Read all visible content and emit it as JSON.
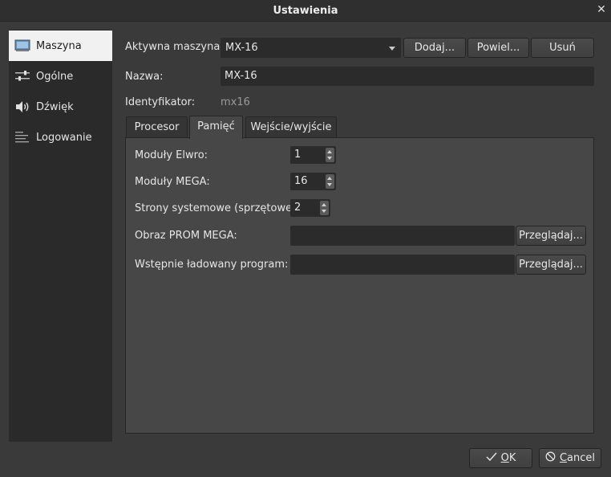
{
  "window": {
    "title": "Ustawienia"
  },
  "sidebar": {
    "items": [
      {
        "label": "Maszyna",
        "icon": "monitor-icon",
        "active": true
      },
      {
        "label": "Ogólne",
        "icon": "sliders-icon",
        "active": false
      },
      {
        "label": "Dźwięk",
        "icon": "speaker-icon",
        "active": false
      },
      {
        "label": "Logowanie",
        "icon": "log-lines-icon",
        "active": false
      }
    ]
  },
  "machine": {
    "active_label": "Aktywna maszyna:",
    "active_value": "MX-16",
    "add_label": "Dodaj...",
    "duplicate_label": "Powiel...",
    "remove_label": "Usuń",
    "name_label": "Nazwa:",
    "name_value": "MX-16",
    "id_label": "Identyfikator:",
    "id_value": "mx16"
  },
  "tabs": [
    {
      "label": "Procesor",
      "active": false
    },
    {
      "label": "Pamięć",
      "active": true
    },
    {
      "label": "Wejście/wyjście",
      "active": false
    }
  ],
  "memory": {
    "elwro_label": "Moduły Elwro:",
    "elwro_value": "1",
    "mega_label": "Moduły MEGA:",
    "mega_value": "16",
    "sys_pages_label": "Strony systemowe (sprzętowe):",
    "sys_pages_value": "2",
    "prom_label": "Obraz PROM MEGA:",
    "prom_value": "",
    "preload_label": "Wstępnie ładowany program:",
    "preload_value": "",
    "browse_label": "Przeglądaj..."
  },
  "dialog": {
    "ok_mnemonic": "O",
    "ok_rest": "K",
    "cancel_mnemonic": "C",
    "cancel_rest": "ancel"
  }
}
